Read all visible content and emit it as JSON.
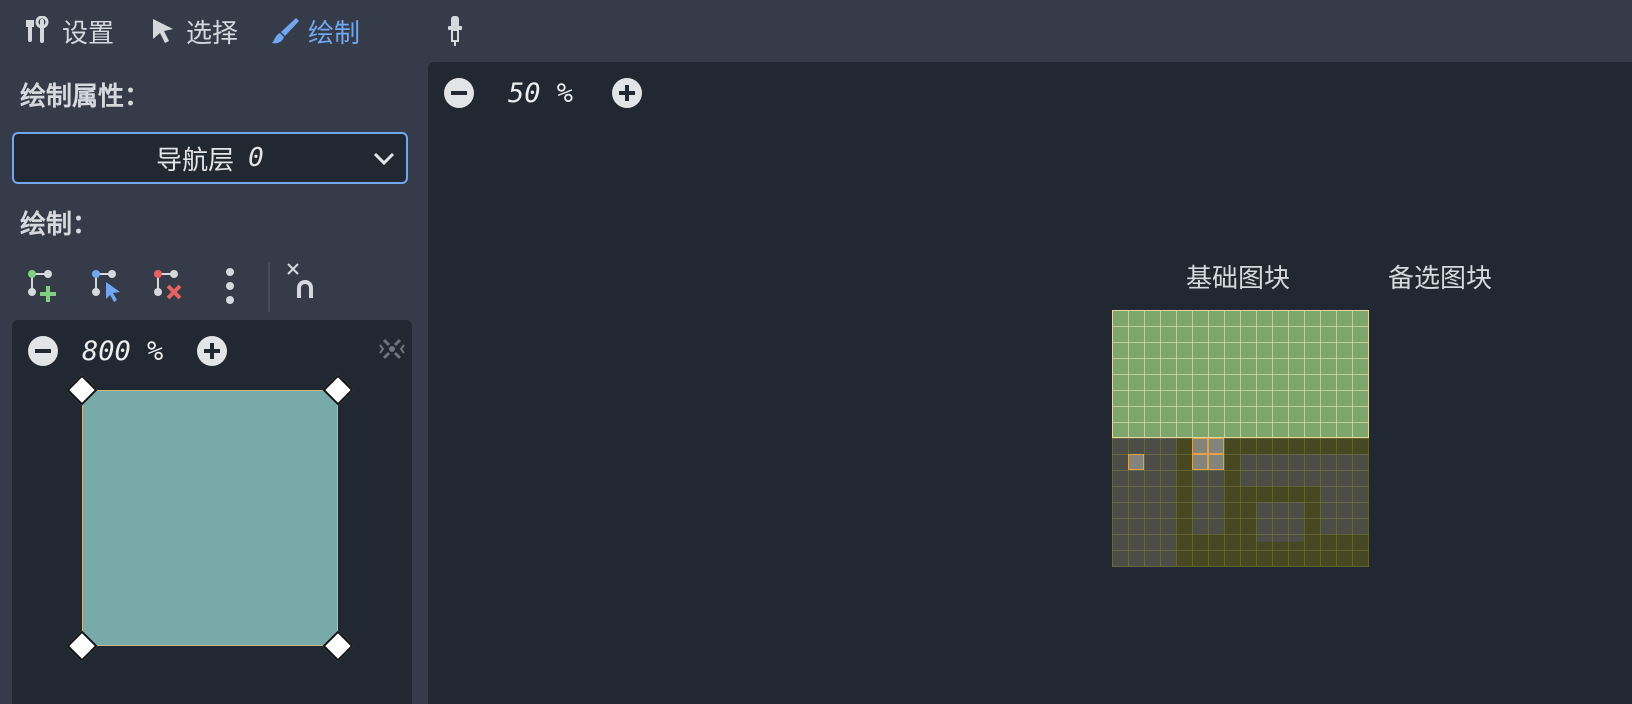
{
  "toolbar": {
    "tabs": [
      {
        "label": "设置",
        "icon": "tools-icon"
      },
      {
        "label": "选择",
        "icon": "cursor-arrow-icon"
      },
      {
        "label": "绘制",
        "icon": "paint-brush-icon",
        "active": true
      }
    ],
    "extra_icon": "eyedropper-icon",
    "active_color": "#70a7f0"
  },
  "left_panel": {
    "paint_properties_label": "绘制属性：",
    "layer_select": {
      "label": "导航层",
      "value": "0"
    },
    "paint_label": "绘制：",
    "tools": [
      {
        "icon": "add-polygon-icon"
      },
      {
        "icon": "select-polygon-icon"
      },
      {
        "icon": "delete-polygon-icon"
      },
      {
        "icon": "more-options-icon"
      },
      {
        "icon": "snap-icon"
      }
    ],
    "tile_editor": {
      "zoom": "800 %",
      "center_icon": "center-view-icon",
      "preview_color": "#78aaaa"
    }
  },
  "atlas_view": {
    "zoom": "50 %",
    "tabs": [
      "基础图块",
      "备选图块"
    ],
    "colors": {
      "grass": "#7ea56c",
      "dirt": "#454820",
      "selection": "#e0a24a"
    }
  }
}
